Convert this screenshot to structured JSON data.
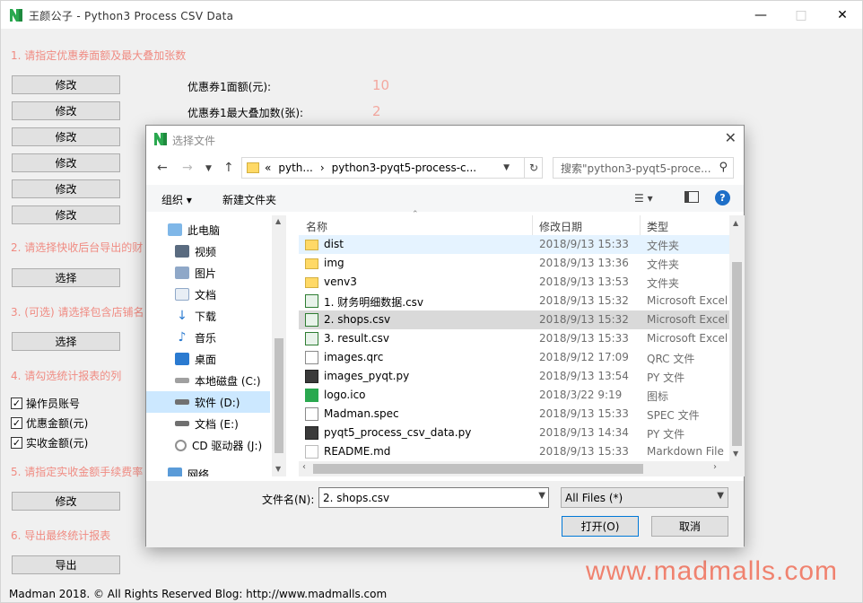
{
  "window": {
    "title": "王颜公子 - Python3 Process CSV Data"
  },
  "steps": {
    "s1": "1. 请指定优惠券面额及最大叠加张数",
    "s2": "2. 请选择快收后台导出的财",
    "s3": "3. (可选) 请选择包含店铺名",
    "s4": "4. 请勾选统计报表的列",
    "s5": "5. 请指定实收金额手续费率",
    "s6": "6. 导出最终统计报表"
  },
  "buttons": {
    "edit": "修改",
    "select": "选择",
    "export": "导出"
  },
  "coupon": {
    "denom_label": "优惠券1面额(元):",
    "denom_value": "10",
    "max_label": "优惠券1最大叠加数(张):",
    "max_value": "2"
  },
  "columns": [
    {
      "label": "操作员账号",
      "checked": "✓"
    },
    {
      "label": "优惠金额(元)",
      "checked": "✓"
    },
    {
      "label": "实收金额(元)",
      "checked": "✓"
    }
  ],
  "footer": "Madman 2018. © All Rights Reserved  Blog: http://www.madmalls.com",
  "watermark": "www.madmalls.com",
  "dialog": {
    "title": "选择文件",
    "address": [
      "«",
      "pyth...",
      "›",
      "python3-pyqt5-process-c..."
    ],
    "search_placeholder": "搜索\"python3-pyqt5-proce...",
    "toolbar": {
      "organize": "组织 ▾",
      "new_folder": "新建文件夹"
    },
    "nav": [
      "此电脑",
      "视频",
      "图片",
      "文档",
      "下载",
      "音乐",
      "桌面",
      "本地磁盘 (C:)",
      "软件 (D:)",
      "文档 (E:)",
      "CD 驱动器 (J:)",
      "网络"
    ],
    "headers": {
      "name": "名称",
      "date": "修改日期",
      "type": "类型"
    },
    "files": [
      {
        "name": "dist",
        "date": "2018/9/13 15:33",
        "type": "文件夹",
        "icon": "folder"
      },
      {
        "name": "img",
        "date": "2018/9/13 13:36",
        "type": "文件夹",
        "icon": "folder"
      },
      {
        "name": "venv3",
        "date": "2018/9/13 13:53",
        "type": "文件夹",
        "icon": "folder"
      },
      {
        "name": "1. 财务明细数据.csv",
        "date": "2018/9/13 15:32",
        "type": "Microsoft Excel",
        "icon": "excel"
      },
      {
        "name": "2. shops.csv",
        "date": "2018/9/13 15:32",
        "type": "Microsoft Excel",
        "icon": "excel"
      },
      {
        "name": "3. result.csv",
        "date": "2018/9/13 15:33",
        "type": "Microsoft Excel",
        "icon": "excel"
      },
      {
        "name": "images.qrc",
        "date": "2018/9/12 17:09",
        "type": "QRC 文件",
        "icon": "file"
      },
      {
        "name": "images_pyqt.py",
        "date": "2018/9/13 13:54",
        "type": "PY 文件",
        "icon": "py"
      },
      {
        "name": "logo.ico",
        "date": "2018/3/22 9:19",
        "type": "图标",
        "icon": "ico"
      },
      {
        "name": "Madman.spec",
        "date": "2018/9/13 15:33",
        "type": "SPEC 文件",
        "icon": "file"
      },
      {
        "name": "pyqt5_process_csv_data.py",
        "date": "2018/9/13 14:34",
        "type": "PY 文件",
        "icon": "py"
      },
      {
        "name": "README.md",
        "date": "2018/9/13 15:33",
        "type": "Markdown File",
        "icon": "md"
      }
    ],
    "filename_label": "文件名(N):",
    "filename_value": "2. shops.csv",
    "filter_value": "All Files  (*)",
    "open_label": "打开(O)",
    "cancel_label": "取消"
  },
  "colors": {
    "accent": "#f08b82",
    "watermark": "#f0826f",
    "selection": "#cce8ff"
  }
}
